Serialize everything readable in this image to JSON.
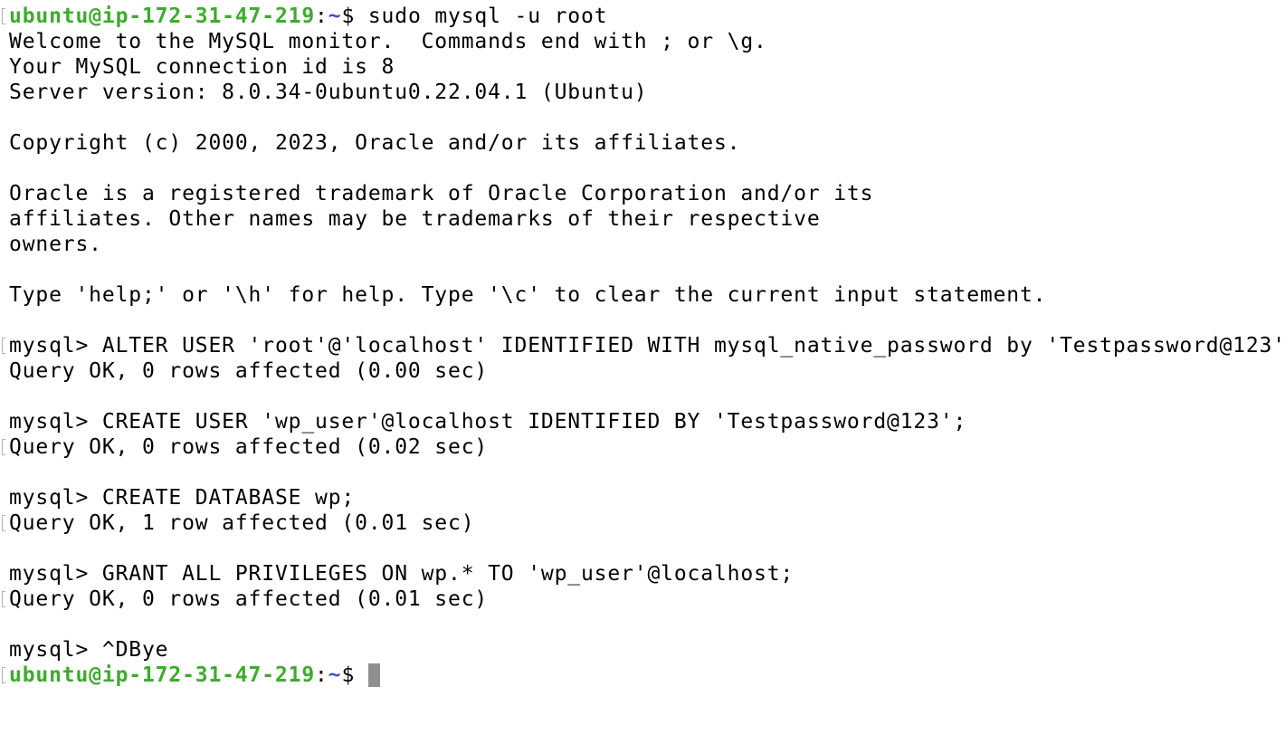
{
  "prompt": {
    "user_host": "ubuntu@ip-172-31-47-219",
    "separator": ":",
    "path": "~",
    "symbol": "$"
  },
  "lines": [
    {
      "kind": "prompt",
      "marked": true,
      "command": " sudo mysql -u root"
    },
    {
      "kind": "text",
      "marked": false,
      "text": "Welcome to the MySQL monitor.  Commands end with ; or \\g."
    },
    {
      "kind": "text",
      "marked": false,
      "text": "Your MySQL connection id is 8"
    },
    {
      "kind": "text",
      "marked": false,
      "text": "Server version: 8.0.34-0ubuntu0.22.04.1 (Ubuntu)"
    },
    {
      "kind": "text",
      "marked": false,
      "text": ""
    },
    {
      "kind": "text",
      "marked": false,
      "text": "Copyright (c) 2000, 2023, Oracle and/or its affiliates."
    },
    {
      "kind": "text",
      "marked": false,
      "text": ""
    },
    {
      "kind": "text",
      "marked": false,
      "text": "Oracle is a registered trademark of Oracle Corporation and/or its"
    },
    {
      "kind": "text",
      "marked": false,
      "text": "affiliates. Other names may be trademarks of their respective"
    },
    {
      "kind": "text",
      "marked": false,
      "text": "owners."
    },
    {
      "kind": "text",
      "marked": false,
      "text": ""
    },
    {
      "kind": "text",
      "marked": false,
      "text": "Type 'help;' or '\\h' for help. Type '\\c' to clear the current input statement."
    },
    {
      "kind": "text",
      "marked": false,
      "text": ""
    },
    {
      "kind": "text",
      "marked": true,
      "text": "mysql> ALTER USER 'root'@'localhost' IDENTIFIED WITH mysql_native_password by 'Testpassword@123';"
    },
    {
      "kind": "text",
      "marked": false,
      "text": "Query OK, 0 rows affected (0.00 sec)"
    },
    {
      "kind": "text",
      "marked": false,
      "text": ""
    },
    {
      "kind": "text",
      "marked": false,
      "text": "mysql> CREATE USER 'wp_user'@localhost IDENTIFIED BY 'Testpassword@123';"
    },
    {
      "kind": "text",
      "marked": true,
      "text": "Query OK, 0 rows affected (0.02 sec)"
    },
    {
      "kind": "text",
      "marked": false,
      "text": ""
    },
    {
      "kind": "text",
      "marked": false,
      "text": "mysql> CREATE DATABASE wp;"
    },
    {
      "kind": "text",
      "marked": true,
      "text": "Query OK, 1 row affected (0.01 sec)"
    },
    {
      "kind": "text",
      "marked": false,
      "text": ""
    },
    {
      "kind": "text",
      "marked": false,
      "text": "mysql> GRANT ALL PRIVILEGES ON wp.* TO 'wp_user'@localhost;"
    },
    {
      "kind": "text",
      "marked": true,
      "text": "Query OK, 0 rows affected (0.01 sec)"
    },
    {
      "kind": "text",
      "marked": false,
      "text": ""
    },
    {
      "kind": "text",
      "marked": false,
      "text": "mysql> ^DBye"
    },
    {
      "kind": "prompt",
      "marked": true,
      "command": " ",
      "cursor": true
    }
  ],
  "colors": {
    "background": "#ffffff",
    "text": "#000000",
    "prompt_user": "#3dab2d",
    "prompt_path": "#3a4fd6",
    "cursor": "#8f8f8f"
  }
}
